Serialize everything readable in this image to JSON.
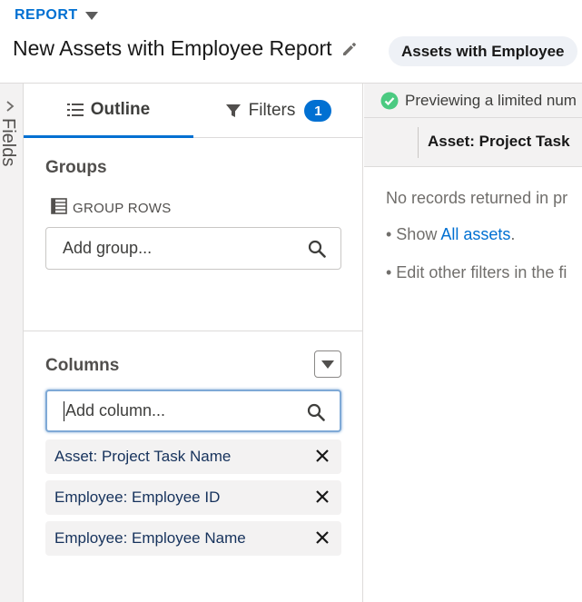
{
  "header": {
    "report_label": "REPORT",
    "title": "New Assets with Employee Report",
    "report_type": "Assets with Employee"
  },
  "fields_rail": {
    "label": "Fields"
  },
  "tabs": {
    "outline": "Outline",
    "filters": "Filters",
    "filters_count": "1"
  },
  "groups": {
    "title": "Groups",
    "group_rows_label": "GROUP ROWS",
    "add_group_placeholder": "Add group..."
  },
  "columns": {
    "title": "Columns",
    "add_column_placeholder": "Add column...",
    "items": [
      {
        "label": "Asset: Project Task Name"
      },
      {
        "label": "Employee: Employee ID"
      },
      {
        "label": "Employee: Employee Name"
      }
    ]
  },
  "preview": {
    "status": "Previewing a limited num",
    "column_header": "Asset: Project Task",
    "empty_line": "No records returned in pr",
    "show_prefix": "• Show ",
    "show_link": "All assets",
    "show_suffix": ".",
    "edit_line": "• Edit other filters in the fi"
  },
  "colors": {
    "accent": "#0070d2",
    "success": "#4bca81",
    "panel_bg": "#f3f2f2"
  },
  "icons": [
    "caret-down-icon",
    "pencil-icon",
    "list-icon",
    "filter-icon",
    "table-icon",
    "search-icon",
    "close-icon",
    "check-circle-icon",
    "chevron-right-icon"
  ]
}
